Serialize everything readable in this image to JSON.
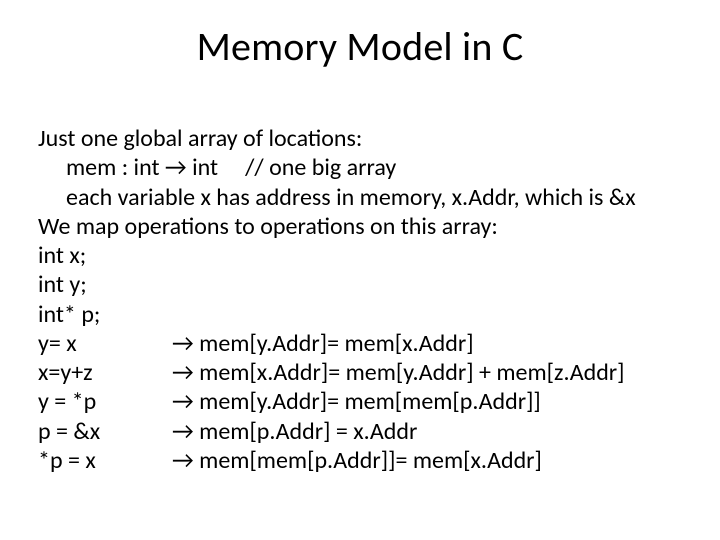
{
  "title": "Memory Model in C",
  "lines": {
    "l1": "Just one global array of locations:",
    "l2_pre": "mem : int ",
    "l2_arrow": "→",
    "l2_post": " int     // one big array",
    "l3": "each variable x has address in memory, x.Addr, which is &x",
    "l4": "We map operations to operations on this array:",
    "l5": "int x;",
    "l6": "int y;",
    "l7": "int* p;"
  },
  "map": [
    {
      "lhs": "y= x",
      "rhs": " mem[y.Addr]= mem[x.Addr]"
    },
    {
      "lhs": "x=y+z",
      "rhs": " mem[x.Addr]= mem[y.Addr] + mem[z.Addr]"
    },
    {
      "lhs": "y = *p",
      "rhs": " mem[y.Addr]= mem[mem[p.Addr]]"
    },
    {
      "lhs": "p = &x",
      "rhs": " mem[p.Addr] = x.Addr"
    },
    {
      "lhs": "*p = x",
      "rhs": " mem[mem[p.Addr]]= mem[x.Addr]"
    }
  ],
  "arrow": "→"
}
